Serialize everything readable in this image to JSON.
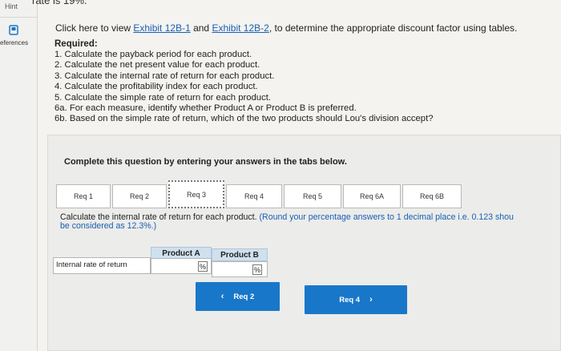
{
  "sidebar": {
    "hint_label": "Hint",
    "references_label": "eferences",
    "references_icon": "book-icon"
  },
  "top_cut_text": "rate is 19%.",
  "intro": {
    "prefix": "Click here to view ",
    "link1": "Exhibit 12B-1",
    "and": " and ",
    "link2": "Exhibit 12B-2",
    "suffix": ", to determine the appropriate discount factor using tables."
  },
  "required": {
    "title": "Required:",
    "items": [
      "1. Calculate the payback period for each product.",
      "2. Calculate the net present value for each product.",
      "3. Calculate the internal rate of return for each product.",
      "4. Calculate the profitability index for each product.",
      "5. Calculate the simple rate of return for each product.",
      "6a. For each measure, identify whether Product A or Product B is preferred.",
      "6b. Based on the simple rate of return, which of the two products should Lou's division accept?"
    ]
  },
  "complete_text": "Complete this question by entering your answers in the tabs below.",
  "tabs": [
    {
      "label": "Req 1",
      "active": false
    },
    {
      "label": "Req 2",
      "active": false
    },
    {
      "label": "Req 3",
      "active": true
    },
    {
      "label": "Req 4",
      "active": false
    },
    {
      "label": "Req 5",
      "active": false
    },
    {
      "label": "Req 6A",
      "active": false
    },
    {
      "label": "Req 6B",
      "active": false
    }
  ],
  "instruction": {
    "line1_start": "Calculate the internal rate of return for each product. ",
    "line1_blue": "(Round your percentage answers to 1 decimal place i.e. 0.123 shou",
    "line2_blue": "be considered as 12.3%.)"
  },
  "table": {
    "col_a": "Product A",
    "col_b": "Product B",
    "row_label": "Internal rate of return",
    "value_a": "",
    "value_b": "",
    "unit": "%"
  },
  "nav": {
    "prev_label": "Req 2",
    "next_label": "Req 4"
  },
  "colors": {
    "accent": "#1877c9",
    "link": "#1a5fb4",
    "table_header": "#cfe0ef"
  }
}
